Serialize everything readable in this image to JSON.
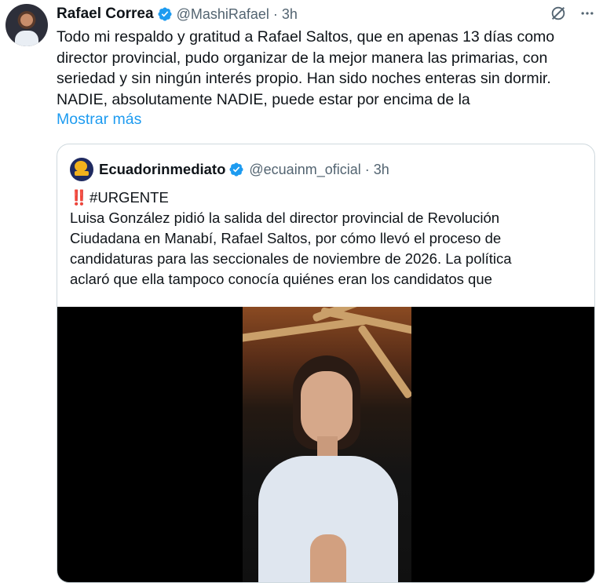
{
  "tweet": {
    "author_name": "Rafael Correa",
    "handle": "@MashiRafael",
    "separator": "·",
    "time": "3h",
    "text": "Todo mi respaldo y gratitud a Rafael Saltos, que en apenas 13 días como\ndirector provincial, pudo organizar de la mejor manera las primarias, con\nseriedad y sin ningún interés propio. Han sido noches enteras sin dormir.\nNADIE, absolutamente NADIE, puede estar por encima de la",
    "show_more": "Mostrar más",
    "icons": {
      "verified": "verified-badge-icon",
      "grok": "grok-icon",
      "more": "more-icon"
    }
  },
  "quote": {
    "author_name": "Ecuadorinmediato",
    "handle": "@ecuainm_oficial",
    "separator": "·",
    "time": "3h",
    "hashtag_prefix": "‼️",
    "hashtag": "#URGENTE",
    "lines": [
      "Luisa González pidió la salida del director provincial de Revolución",
      "Ciudadana en Manabí, Rafael Saltos, por cómo llevó el proceso de",
      "candidaturas para las seccionales de noviembre de 2026. La política",
      "aclaró que ella tampoco conocía quiénes eran los candidatos que"
    ]
  },
  "colors": {
    "accent": "#1d9bf0",
    "secondary_text": "#536471",
    "border": "#cfd9de",
    "alert": "#d9253b"
  }
}
